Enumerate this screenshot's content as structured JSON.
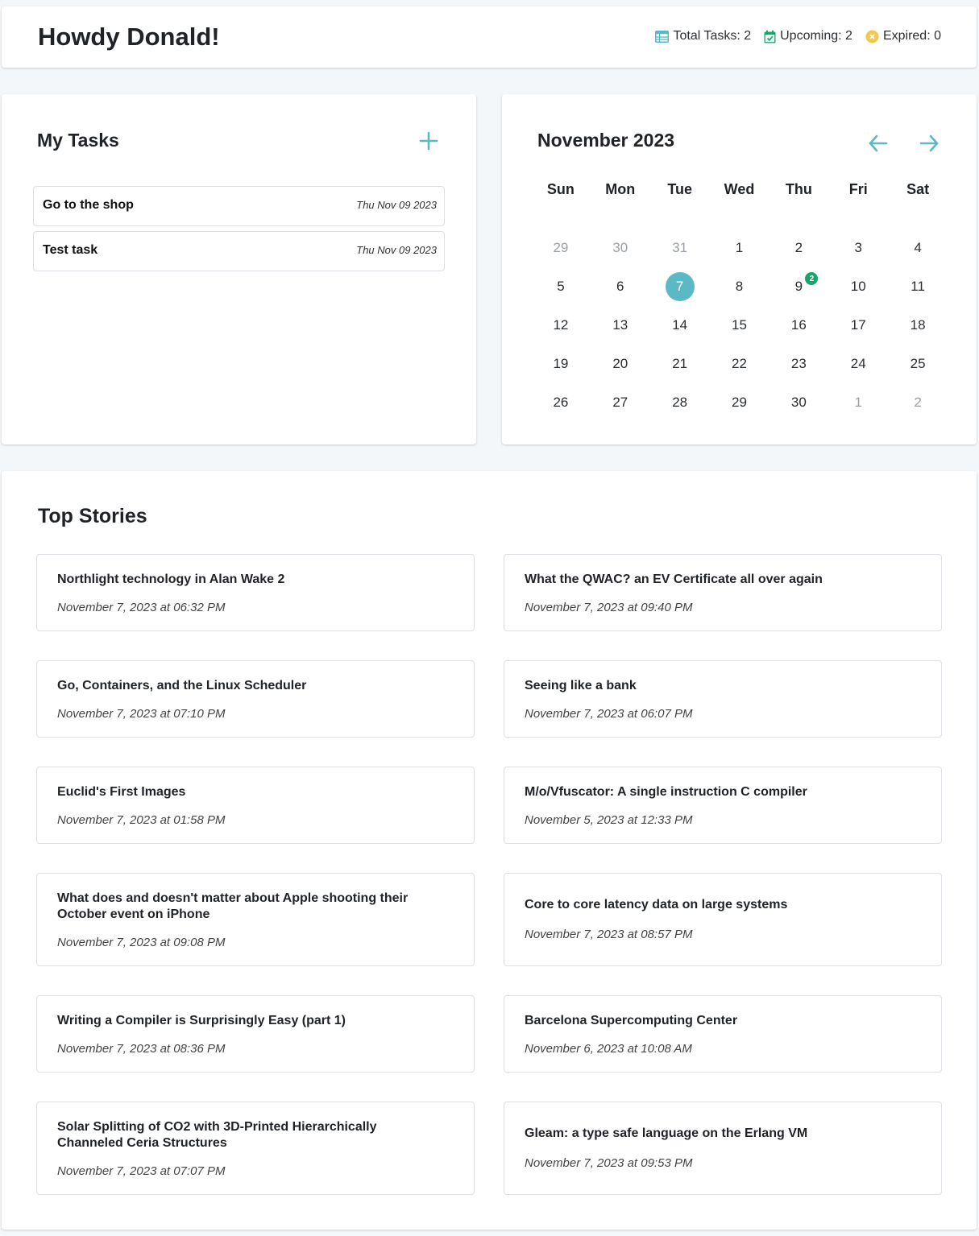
{
  "header": {
    "greeting": "Howdy Donald!",
    "stats": {
      "total_label": "Total Tasks: 2",
      "upcoming_label": "Upcoming: 2",
      "expired_label": "Expired: 0"
    },
    "icons": [
      "table-icon",
      "calendar-check-icon",
      "x-circle-icon"
    ]
  },
  "tasks": {
    "title": "My Tasks",
    "add_icon": "plus-icon",
    "items": [
      {
        "name": "Go to the shop",
        "date": "Thu Nov 09 2023"
      },
      {
        "name": "Test task",
        "date": "Thu Nov 09 2023"
      }
    ]
  },
  "calendar": {
    "title": "November 2023",
    "prev_icon": "arrow-left-icon",
    "next_icon": "arrow-right-icon",
    "weekdays": [
      "Sun",
      "Mon",
      "Tue",
      "Wed",
      "Thu",
      "Fri",
      "Sat"
    ],
    "weeks": [
      [
        "29",
        "30",
        "31",
        "1",
        "2",
        "3",
        "4"
      ],
      [
        "5",
        "6",
        "7",
        "8",
        "9",
        "10",
        "11"
      ],
      [
        "12",
        "13",
        "14",
        "15",
        "16",
        "17",
        "18"
      ],
      [
        "19",
        "20",
        "21",
        "22",
        "23",
        "24",
        "25"
      ],
      [
        "26",
        "27",
        "28",
        "29",
        "30",
        "1",
        "2"
      ]
    ],
    "today": "7",
    "task_badge": {
      "day": "9",
      "count": "2"
    }
  },
  "stories": {
    "title": "Top Stories",
    "items": [
      {
        "title": "Northlight technology in Alan Wake 2",
        "date": "November 7, 2023 at 06:32 PM"
      },
      {
        "title": "What the QWAC? an EV Certificate all over again",
        "date": "November 7, 2023 at 09:40 PM"
      },
      {
        "title": "Go, Containers, and the Linux Scheduler",
        "date": "November 7, 2023 at 07:10 PM"
      },
      {
        "title": "Seeing like a bank",
        "date": "November 7, 2023 at 06:07 PM"
      },
      {
        "title": "Euclid's First Images",
        "date": "November 7, 2023 at 01:58 PM"
      },
      {
        "title": "M/o/Vfuscator: A single instruction C compiler",
        "date": "November 5, 2023 at 12:33 PM"
      },
      {
        "title": "What does and doesn't matter about Apple shooting their October event on iPhone",
        "date": "November 7, 2023 at 09:08 PM"
      },
      {
        "title": "Core to core latency data on large systems",
        "date": "November 7, 2023 at 08:57 PM"
      },
      {
        "title": "Writing a Compiler is Surprisingly Easy (part 1)",
        "date": "November 7, 2023 at 08:36 PM"
      },
      {
        "title": "Barcelona Supercomputing Center",
        "date": "November 6, 2023 at 10:08 AM"
      },
      {
        "title": "Solar Splitting of CO2 with 3D-Printed Hierarchically Channeled Ceria Structures",
        "date": "November 7, 2023 at 07:07 PM"
      },
      {
        "title": "Gleam: a type safe language on the Erlang VM",
        "date": "November 7, 2023 at 09:53 PM"
      }
    ]
  },
  "colors": {
    "accent": "#5bb8c5",
    "badge": "#1aa36b",
    "expired": "#f2c94c",
    "background": "#f4f7fa"
  }
}
